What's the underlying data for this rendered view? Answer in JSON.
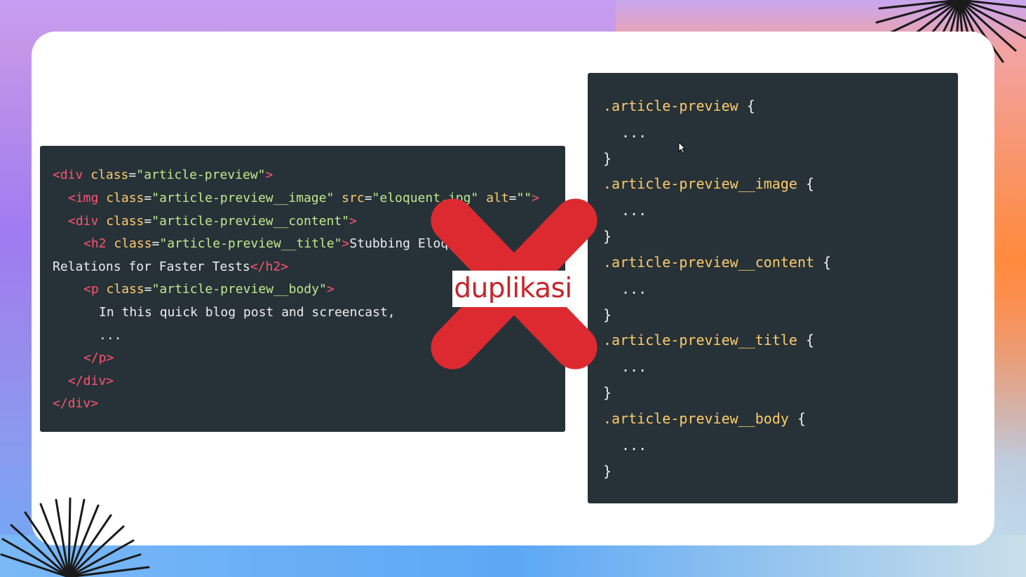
{
  "html_snippet": {
    "line1": {
      "open": "<div",
      "attr": " class",
      "eq": "=",
      "val": "\"article-preview\"",
      "close": ">"
    },
    "line2": {
      "open": "<img",
      "attr": " class",
      "eq": "=",
      "val": "\"article-preview__image\"",
      "attr2": " src",
      "eq2": "=",
      "val2": "\"eloquent.jpg\"",
      "attr3": " alt",
      "eq3": "=",
      "val3": "\"\"",
      "close": ">"
    },
    "line3": {
      "open": "<div",
      "attr": " class",
      "eq": "=",
      "val": "\"article-preview__content\"",
      "close": ">"
    },
    "line4": {
      "open": "<h2",
      "attr": " class",
      "eq": "=",
      "val": "\"article-preview__title\"",
      "close": ">",
      "text": "Stubbing Eloquent"
    },
    "line5": {
      "text": "Relations for Faster Tests",
      "close_tag": "</h2>"
    },
    "line6": {
      "open": "<p",
      "attr": " class",
      "eq": "=",
      "val": "\"article-preview__body\"",
      "close": ">"
    },
    "line7": {
      "text": "In this quick blog post and screencast,"
    },
    "line8": {
      "text": "..."
    },
    "line9": {
      "close_tag": "</p>"
    },
    "line10": {
      "close_tag": "</div>"
    },
    "line11": {
      "close_tag": "</div>"
    }
  },
  "css_snippet": {
    "rules": [
      {
        "selector": ".article-preview",
        "open": "{",
        "body": "...",
        "close": "}"
      },
      {
        "selector": ".article-preview__image",
        "open": "{",
        "body": "...",
        "close": "}"
      },
      {
        "selector": ".article-preview__content",
        "open": "{",
        "body": "...",
        "close": "}"
      },
      {
        "selector": ".article-preview__title",
        "open": "{",
        "body": "...",
        "close": "}"
      },
      {
        "selector": ".article-preview__body",
        "open": "{",
        "body": "...",
        "close": "}"
      }
    ]
  },
  "overlay": {
    "label": "duplikasi",
    "mark_icon": "cross-icon",
    "mark_color": "#dc2a30"
  },
  "colors": {
    "code_bg": "#263238",
    "tag": "#ff5370",
    "attr": "#ffcb6b",
    "string": "#c3e88d"
  }
}
